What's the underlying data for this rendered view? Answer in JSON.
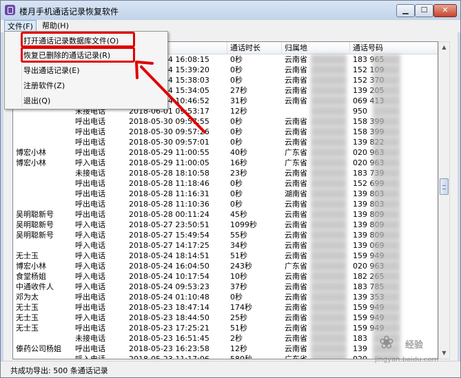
{
  "window": {
    "title": "楼月手机通话记录恢复软件"
  },
  "menubar": {
    "file": "文件(F)",
    "help": "帮助(H)"
  },
  "file_menu": {
    "items": [
      "打开通话记录数据库文件(O)",
      "恢复已删除的通话记录(R)",
      "导出通话记录(E)",
      "注册软件(Z)",
      "退出(Q)"
    ]
  },
  "table": {
    "columns": [
      "",
      "",
      "",
      "通话时长",
      "归属地",
      "通话号码"
    ],
    "rows": [
      [
        "",
        "",
        "2018-06-04 16:08:15",
        "0秒",
        "云南省",
        "183        965"
      ],
      [
        "",
        "",
        "2018-06-04 15:39:20",
        "0秒",
        "云南省",
        "152        109"
      ],
      [
        "",
        "",
        "2018-06-04 15:38:03",
        "0秒",
        "云南省",
        "152        370"
      ],
      [
        "",
        "",
        "2018-06-04 15:34:05",
        "27秒",
        "云南省",
        "139        205"
      ],
      [
        "",
        "",
        "2018-06-04 10:46:52",
        "31秒",
        "云南省",
        "069        413"
      ],
      [
        "",
        "未接电话",
        "2018-06-01 09:53:17",
        "12秒",
        "",
        "950"
      ],
      [
        "",
        "呼出电话",
        "2018-05-30 09:57:55",
        "0秒",
        "云南省",
        "158        399"
      ],
      [
        "",
        "呼出电话",
        "2018-05-30 09:57:26",
        "0秒",
        "云南省",
        "158        399"
      ],
      [
        "",
        "呼出电话",
        "2018-05-30 09:57:01",
        "0秒",
        "云南省",
        "139        822"
      ],
      [
        "博宏小林",
        "呼出电话",
        "2018-05-29 11:00:55",
        "40秒",
        "广东省",
        "020        963"
      ],
      [
        "博宏小林",
        "呼入电话",
        "2018-05-29 11:00:05",
        "16秒",
        "广东省",
        "020        963"
      ],
      [
        "",
        "未接电话",
        "2018-05-28 18:10:58",
        "23秒",
        "云南省",
        "183        739"
      ],
      [
        "",
        "呼出电话",
        "2018-05-28 11:18:46",
        "0秒",
        "云南省",
        "152        699"
      ],
      [
        "",
        "呼出电话",
        "2018-05-28 11:16:31",
        "0秒",
        "湖南省",
        "139        803"
      ],
      [
        "",
        "呼出电话",
        "2018-05-28 11:10:36",
        "0秒",
        "云南省",
        "139        803"
      ],
      [
        "吴明聪新号",
        "呼出电话",
        "2018-05-28 00:11:24",
        "45秒",
        "云南省",
        "139        809"
      ],
      [
        "吴明聪新号",
        "呼入电话",
        "2018-05-27 23:50:51",
        "1099秒",
        "云南省",
        "139        809"
      ],
      [
        "吴明聪新号",
        "呼入电话",
        "2018-05-27 15:49:54",
        "55秒",
        "云南省",
        "139        809"
      ],
      [
        "",
        "呼入电话",
        "2018-05-27 14:17:25",
        "34秒",
        "云南省",
        "139        069"
      ],
      [
        "无士玉",
        "呼入电话",
        "2018-05-24 18:14:51",
        "51秒",
        "云南省",
        "159        949"
      ],
      [
        "博宏小林",
        "呼入电话",
        "2018-05-24 16:04:50",
        "243秒",
        "广东省",
        "020        963"
      ],
      [
        "食堂杨姐",
        "呼入电话",
        "2018-05-24 10:17:54",
        "10秒",
        "云南省",
        "182        265"
      ],
      [
        "中通收件人",
        "呼入电话",
        "2018-05-24 09:53:23",
        "37秒",
        "云南省",
        "183        785"
      ],
      [
        "邓为太",
        "呼出电话",
        "2018-05-24 01:10:48",
        "0秒",
        "云南省",
        "139        353"
      ],
      [
        "无士玉",
        "呼出电话",
        "2018-05-23 18:47:14",
        "174秒",
        "云南省",
        "159        949"
      ],
      [
        "无士玉",
        "呼入电话",
        "2018-05-23 18:44:50",
        "25秒",
        "云南省",
        "159        949"
      ],
      [
        "无士玉",
        "呼出电话",
        "2018-05-23 17:25:21",
        "51秒",
        "云南省",
        "159        949"
      ],
      [
        "",
        "未接电话",
        "2018-05-23 16:51:45",
        "2秒",
        "云南省",
        "183        "
      ],
      [
        "傣药公司杨姐",
        "呼出电话",
        "2018-05-23 16:23:58",
        "12秒",
        "云南省",
        "139        "
      ],
      [
        "",
        "呼入电话",
        "2018-05-23 11:17:06",
        "580秒",
        "广东省",
        "020        "
      ]
    ]
  },
  "status": {
    "text": "共成功导出: 500 条通话记录"
  },
  "watermark": {
    "text": "经验",
    "url": "jingyan.baidu.com"
  },
  "colors": {
    "highlight_red": "#e00000"
  }
}
